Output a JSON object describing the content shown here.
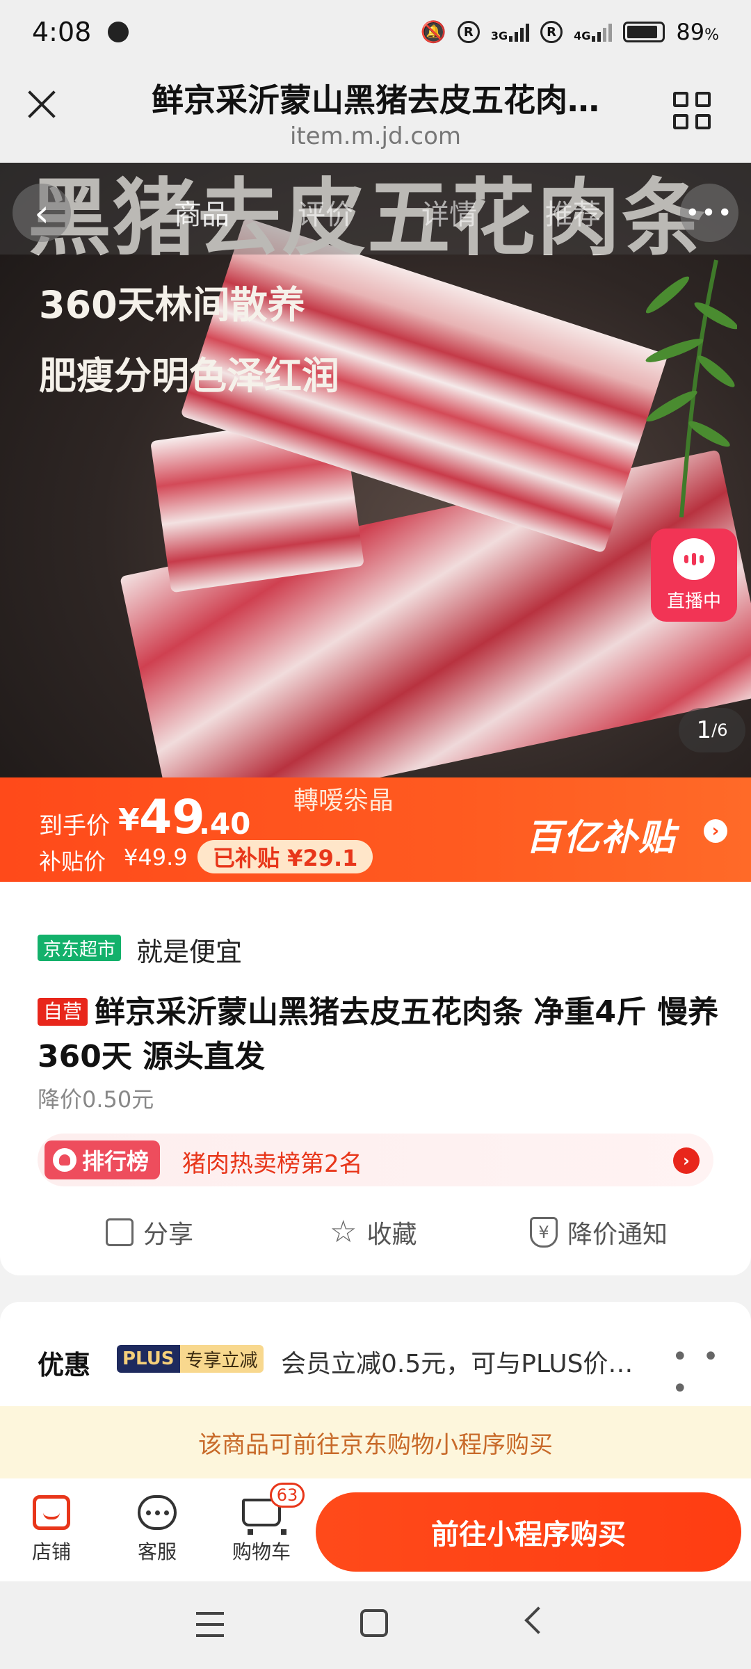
{
  "status_bar": {
    "time": "4:08",
    "network_3g": "3G",
    "network_4g": "4G",
    "roaming": "R",
    "battery": "89",
    "battery_unit": "%",
    "battery_level": 0.89
  },
  "browser": {
    "title": "鲜京采沂蒙山黑猪去皮五花肉…",
    "url": "item.m.jd.com"
  },
  "hero": {
    "banner": "黑猪去皮五花肉条",
    "sub1": "360天林间散养",
    "sub2": "肥瘦分明色泽红润",
    "tabs": [
      "商品",
      "评价",
      "详情",
      "推荐"
    ],
    "live_label": "直播中",
    "counter_current": "1",
    "counter_total": "/6"
  },
  "price_bar": {
    "store_tag": "轉嗳尜晶",
    "price_label": "到手价",
    "currency": "¥",
    "price_int": "49",
    "price_dec": ".40",
    "subsidy_label": "补贴价",
    "subsidy_price": "¥49.9",
    "saved": "已补贴 ¥29.1",
    "subsidy_logo": "百亿补贴"
  },
  "product": {
    "channel_badge": "京东超市",
    "slogan": "就是便宜",
    "self_badge": "自营",
    "title": "鲜京采沂蒙山黑猪去皮五花肉条 净重4斤 慢养360天 源头直发",
    "price_drop": "降价0.50元",
    "rank_label": "排行榜",
    "rank_text": "猪肉热卖榜第2名",
    "actions": {
      "share": "分享",
      "favorite": "收藏",
      "price_alert": "降价通知"
    }
  },
  "promo": {
    "label": "优惠",
    "plus": "PLUS",
    "plus_tag": "专享立减",
    "text": "会员立减0.5元，可与PLUS价…",
    "more": "• • •"
  },
  "notice": "该商品可前往京东购物小程序购买",
  "bottom_bar": {
    "store": "店铺",
    "service": "客服",
    "cart": "购物车",
    "cart_count": "63",
    "buy": "前往小程序购买"
  },
  "colors": {
    "accent": "#ff4a1a",
    "jd_green": "#13b16b",
    "live_pink": "#f23455"
  }
}
